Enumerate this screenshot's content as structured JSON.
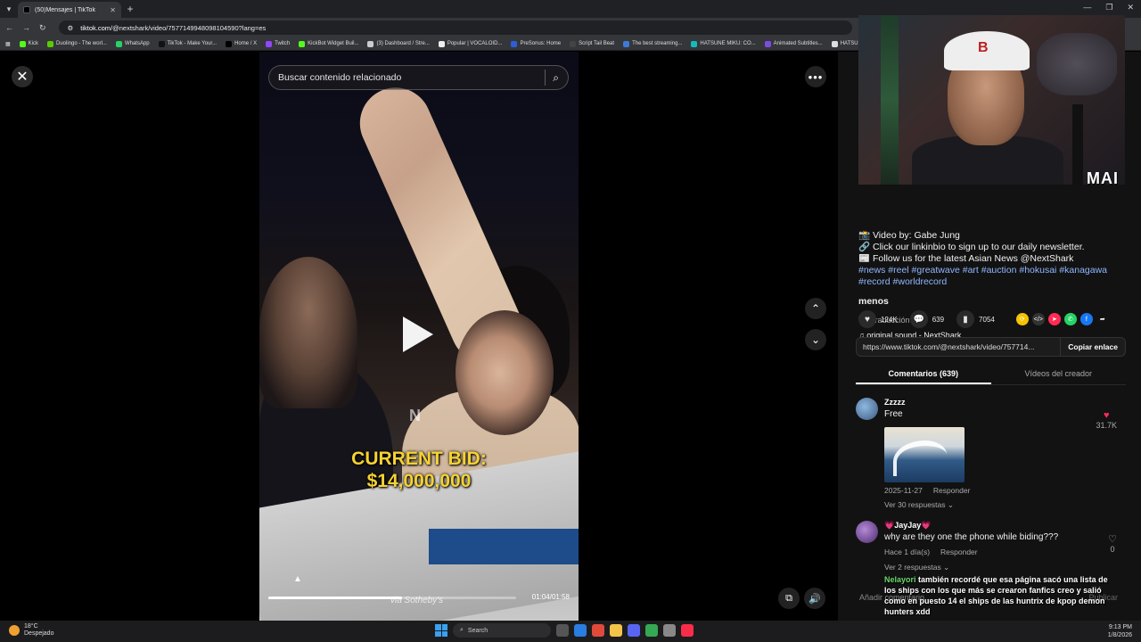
{
  "browser": {
    "tab_title": "(50)Mensajes | TikTok",
    "url_host": "tiktok.com",
    "url_path": "/@nextshark/video/7577149948098104590?lang=es",
    "bookmarks": [
      "Kick",
      "Duolingo - The worl...",
      "WhatsApp",
      "TikTok - Make Your...",
      "Home / X",
      "Twitch",
      "KickBot Widget Buil...",
      "(3) Dashboard / Stre...",
      "Popular | VOCALOID...",
      "PreSonus: Home",
      "Script Tail Beat",
      "The best streaming...",
      "HATSUNE MIKU: CO...",
      "Animated Subtitles...",
      "HATSUNE"
    ]
  },
  "video": {
    "search_placeholder": "Buscar contenido relacionado",
    "bid_line1": "CURRENT BID:",
    "bid_line2": "$14,000,000",
    "watermark": "N",
    "credit": "via Sotheby's",
    "time": "01:04/01:58",
    "progress": 0.54
  },
  "webcam": {
    "overlay_label": "MAI"
  },
  "description": {
    "line1": "📸 Video by: Gabe Jung",
    "line2": "🔗 Click our linkinbio to sign up to our daily newsletter.",
    "line3": "📰 Follow us for the latest Asian News @NextShark",
    "tags": "#news #reel #greatwave #art #auction #hokusai #kanagawa #record #worldrecord",
    "menos": "menos",
    "ver_traduccion": "Ver traducción",
    "sound": "original sound - NextShark"
  },
  "actions": {
    "likes": "124K",
    "comments": "639",
    "saves": "7054"
  },
  "link": {
    "url": "https://www.tiktok.com/@nextshark/video/757714...",
    "copy_label": "Copiar enlace"
  },
  "tabs": {
    "comments": "Comentarios (639)",
    "creator_videos": "Vídeos del creador"
  },
  "comments": [
    {
      "name": "Zzzzz",
      "text": "Free",
      "date": "2025-11-27",
      "reply": "Responder",
      "likes": "31.7K",
      "view_replies": "Ver 30 respuestas"
    },
    {
      "name": "💗JayJay💗",
      "text": "why are they one the phone while biding???",
      "date": "Hace 1 día(s)",
      "reply": "Responder",
      "likes": "0",
      "view_replies": "Ver 2 respuestas"
    }
  ],
  "chat_overlay": {
    "name": "Nelayori",
    "text": "también recordé que esa página sacó una lista de los ships con los que más se crearon fanfics creo y salió como en puesto 14 el ships de las huntrix de kpop demon hunters xdd"
  },
  "add_comment": {
    "placeholder": "Añadir comentario...",
    "publish": "Publicar"
  },
  "taskbar": {
    "temp": "18°C",
    "weather": "Despejado",
    "search": "Search",
    "time": "9:13 PM",
    "date": "1/8/2026"
  }
}
